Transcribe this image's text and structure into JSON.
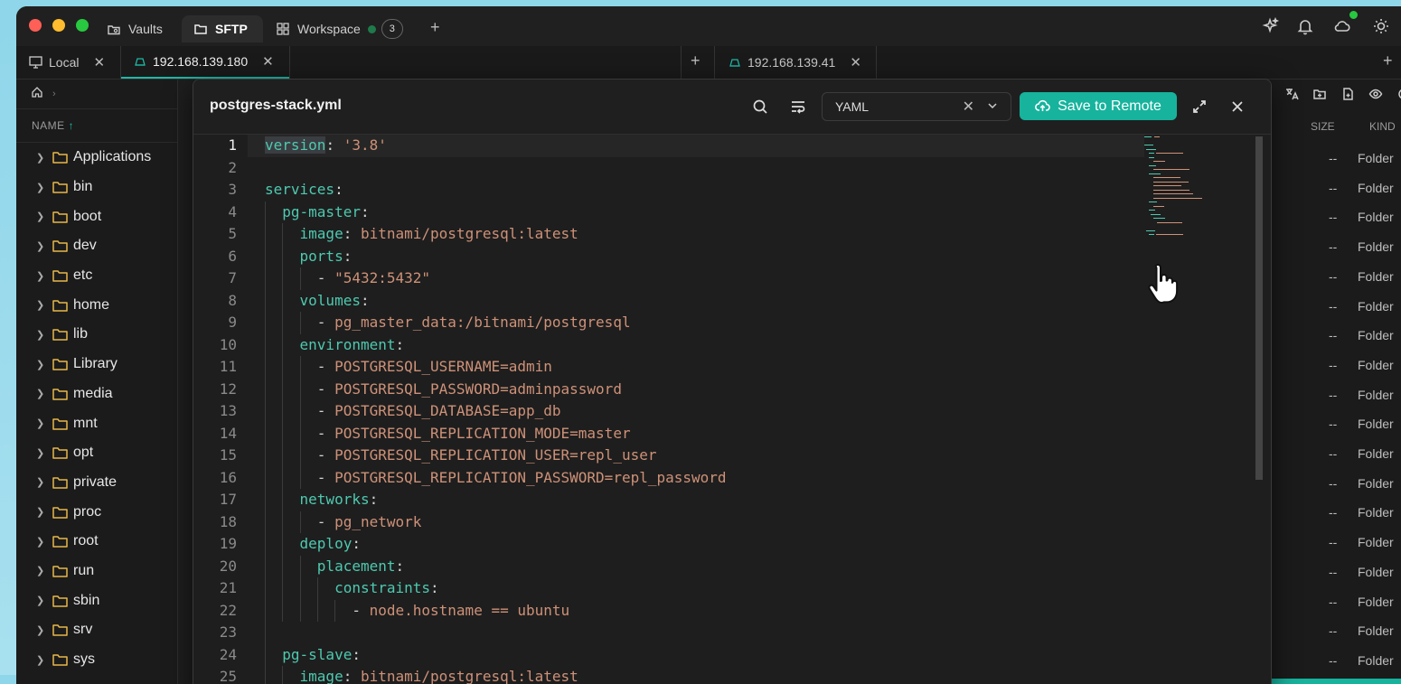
{
  "titlebar": {
    "tabs": [
      {
        "label": "Vaults",
        "icon": "vault-icon"
      },
      {
        "label": "SFTP",
        "icon": "folder-icon"
      },
      {
        "label": "Workspace",
        "icon": "grid-icon",
        "badge": "3"
      }
    ]
  },
  "sessions": {
    "local": "Local",
    "remote1": "192.168.139.180",
    "remote2": "192.168.139.41"
  },
  "left_panel": {
    "col_name": "NAME",
    "folders": [
      "Applications",
      "bin",
      "boot",
      "dev",
      "etc",
      "home",
      "lib",
      "Library",
      "media",
      "mnt",
      "opt",
      "private",
      "proc",
      "root",
      "run",
      "sbin",
      "srv",
      "sys"
    ]
  },
  "right_panel": {
    "col_size": "SIZE",
    "col_kind": "KIND",
    "size_value": "--",
    "kind_value": "Folder"
  },
  "editor": {
    "filename": "postgres-stack.yml",
    "language": "YAML",
    "save_label": "Save to Remote",
    "lines": [
      {
        "n": "1",
        "indent": "",
        "key": "version",
        "sep": ": ",
        "val": "'3.8'"
      },
      {
        "n": "2",
        "indent": "",
        "key": "",
        "sep": "",
        "val": ""
      },
      {
        "n": "3",
        "indent": "",
        "key": "services",
        "sep": ":",
        "val": ""
      },
      {
        "n": "4",
        "indent": "  ",
        "key": "pg-master",
        "sep": ":",
        "val": ""
      },
      {
        "n": "5",
        "indent": "    ",
        "key": "image",
        "sep": ": ",
        "val": "bitnami/postgresql:latest"
      },
      {
        "n": "6",
        "indent": "    ",
        "key": "ports",
        "sep": ":",
        "val": ""
      },
      {
        "n": "7",
        "indent": "      ",
        "key": "",
        "sep": "- ",
        "val": "\"5432:5432\""
      },
      {
        "n": "8",
        "indent": "    ",
        "key": "volumes",
        "sep": ":",
        "val": ""
      },
      {
        "n": "9",
        "indent": "      ",
        "key": "",
        "sep": "- ",
        "val": "pg_master_data:/bitnami/postgresql"
      },
      {
        "n": "10",
        "indent": "    ",
        "key": "environment",
        "sep": ":",
        "val": ""
      },
      {
        "n": "11",
        "indent": "      ",
        "key": "",
        "sep": "- ",
        "val": "POSTGRESQL_USERNAME=admin"
      },
      {
        "n": "12",
        "indent": "      ",
        "key": "",
        "sep": "- ",
        "val": "POSTGRESQL_PASSWORD=adminpassword"
      },
      {
        "n": "13",
        "indent": "      ",
        "key": "",
        "sep": "- ",
        "val": "POSTGRESQL_DATABASE=app_db"
      },
      {
        "n": "14",
        "indent": "      ",
        "key": "",
        "sep": "- ",
        "val": "POSTGRESQL_REPLICATION_MODE=master"
      },
      {
        "n": "15",
        "indent": "      ",
        "key": "",
        "sep": "- ",
        "val": "POSTGRESQL_REPLICATION_USER=repl_user"
      },
      {
        "n": "16",
        "indent": "      ",
        "key": "",
        "sep": "- ",
        "val": "POSTGRESQL_REPLICATION_PASSWORD=repl_password"
      },
      {
        "n": "17",
        "indent": "    ",
        "key": "networks",
        "sep": ":",
        "val": ""
      },
      {
        "n": "18",
        "indent": "      ",
        "key": "",
        "sep": "- ",
        "val": "pg_network"
      },
      {
        "n": "19",
        "indent": "    ",
        "key": "deploy",
        "sep": ":",
        "val": ""
      },
      {
        "n": "20",
        "indent": "      ",
        "key": "placement",
        "sep": ":",
        "val": ""
      },
      {
        "n": "21",
        "indent": "        ",
        "key": "constraints",
        "sep": ":",
        "val": ""
      },
      {
        "n": "22",
        "indent": "          ",
        "key": "",
        "sep": "- ",
        "val": "node.hostname == ubuntu"
      },
      {
        "n": "23",
        "indent": "",
        "key": "",
        "sep": "",
        "val": ""
      },
      {
        "n": "24",
        "indent": "  ",
        "key": "pg-slave",
        "sep": ":",
        "val": ""
      },
      {
        "n": "25",
        "indent": "    ",
        "key": "image",
        "sep": ": ",
        "val": "bitnami/postgresql:latest"
      }
    ]
  },
  "colors": {
    "accent": "#17b39d",
    "key": "#4ec9b0",
    "string": "#ce9178",
    "folder": "#e8b84a"
  }
}
